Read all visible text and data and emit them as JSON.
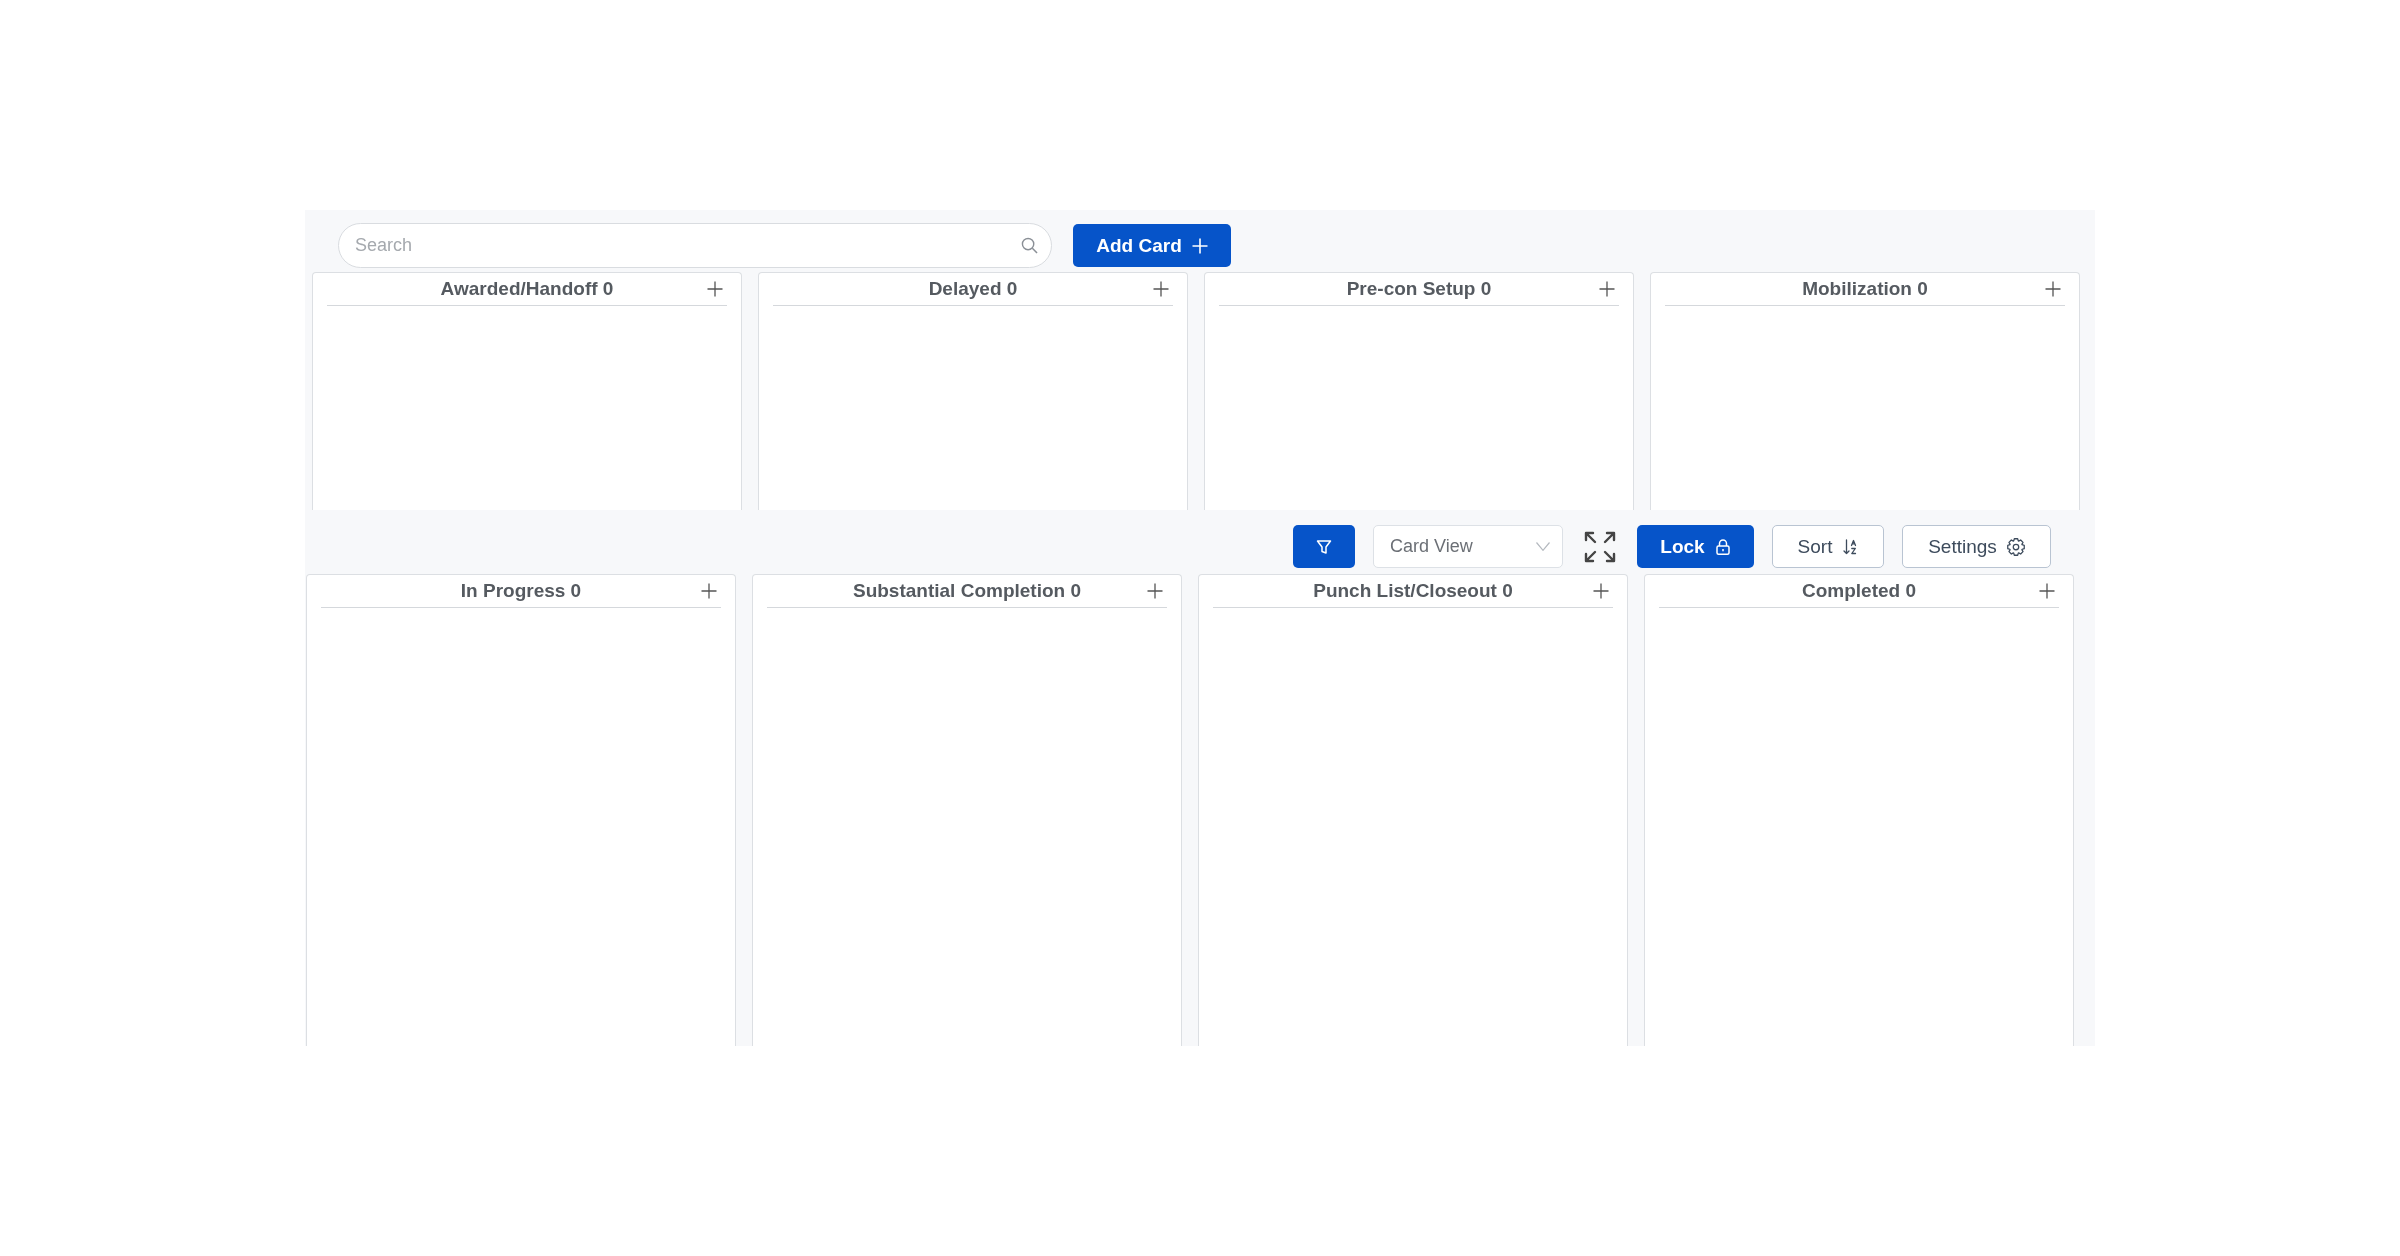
{
  "board_top": {
    "search": {
      "placeholder": "Search"
    },
    "add_card_button": "Add Card",
    "columns": [
      {
        "title": "Awarded/Handoff 0"
      },
      {
        "title": "Delayed 0"
      },
      {
        "title": "Pre-con Setup 0"
      },
      {
        "title": "Mobilization 0"
      }
    ]
  },
  "board_bottom": {
    "toolbar": {
      "view_select": {
        "value": "Card View"
      },
      "lock_button": "Lock",
      "sort_button": "Sort",
      "settings_button": "Settings"
    },
    "columns": [
      {
        "title": "In Progress 0"
      },
      {
        "title": "Substantial Completion 0"
      },
      {
        "title": "Punch List/Closeout 0"
      },
      {
        "title": "Completed 0"
      }
    ]
  }
}
